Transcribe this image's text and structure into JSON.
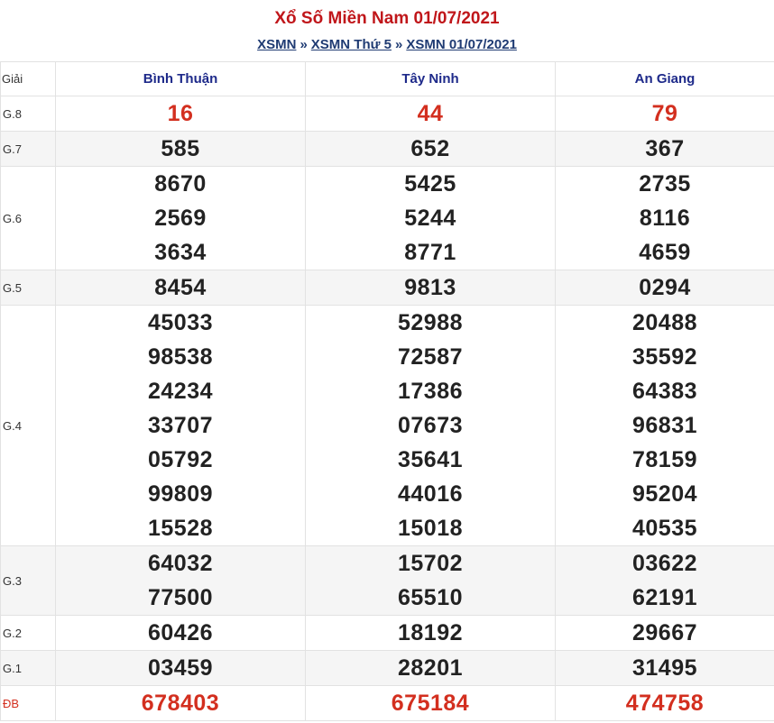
{
  "header": {
    "title": "Xổ Số Miền Nam 01/07/2021",
    "breadcrumb": [
      "XSMN",
      "XSMN Thứ 5",
      "XSMN 01/07/2021"
    ],
    "separator": "»"
  },
  "table": {
    "prize_header": "Giải",
    "provinces": [
      "Bình Thuận",
      "Tây Ninh",
      "An Giang"
    ],
    "rows": [
      {
        "label": "G.8",
        "values": [
          [
            "16"
          ],
          [
            "44"
          ],
          [
            "79"
          ]
        ]
      },
      {
        "label": "G.7",
        "values": [
          [
            "585"
          ],
          [
            "652"
          ],
          [
            "367"
          ]
        ]
      },
      {
        "label": "G.6",
        "values": [
          [
            "8670",
            "2569",
            "3634"
          ],
          [
            "5425",
            "5244",
            "8771"
          ],
          [
            "2735",
            "8116",
            "4659"
          ]
        ]
      },
      {
        "label": "G.5",
        "values": [
          [
            "8454"
          ],
          [
            "9813"
          ],
          [
            "0294"
          ]
        ]
      },
      {
        "label": "G.4",
        "values": [
          [
            "45033",
            "98538",
            "24234",
            "33707",
            "05792",
            "99809",
            "15528"
          ],
          [
            "52988",
            "72587",
            "17386",
            "07673",
            "35641",
            "44016",
            "15018"
          ],
          [
            "20488",
            "35592",
            "64383",
            "96831",
            "78159",
            "95204",
            "40535"
          ]
        ]
      },
      {
        "label": "G.3",
        "values": [
          [
            "64032",
            "77500"
          ],
          [
            "15702",
            "65510"
          ],
          [
            "03622",
            "62191"
          ]
        ]
      },
      {
        "label": "G.2",
        "values": [
          [
            "60426"
          ],
          [
            "18192"
          ],
          [
            "29667"
          ]
        ]
      },
      {
        "label": "G.1",
        "values": [
          [
            "03459"
          ],
          [
            "28201"
          ],
          [
            "31495"
          ]
        ]
      },
      {
        "label": "ĐB",
        "values": [
          [
            "678403"
          ],
          [
            "675184"
          ],
          [
            "474758"
          ]
        ]
      }
    ]
  },
  "colors": {
    "title": "#c0161a",
    "link": "#1f3b73",
    "province": "#1e2a8a",
    "highlight": "#d32f1f",
    "alt_row": "#f5f5f5"
  }
}
